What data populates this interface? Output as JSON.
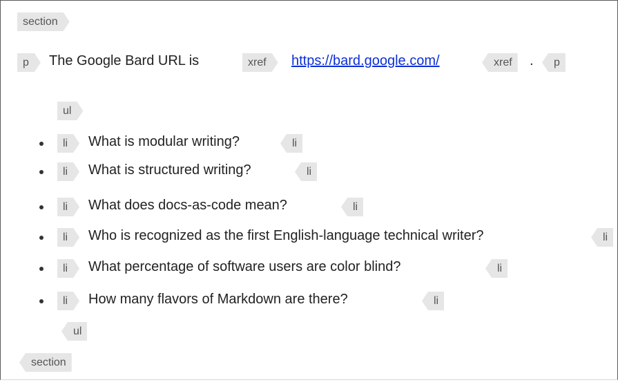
{
  "section_tag": "section",
  "paragraph": {
    "p_tag": "p",
    "lead_text": "The Google Bard URL is",
    "xref_tag": "xref",
    "link_text": "https://bard.google.com/",
    "trailing": "."
  },
  "list": {
    "ul_tag": "ul",
    "li_tag": "li",
    "items": [
      "What is modular writing?",
      "What is structured writing?",
      "What does docs-as-code mean?",
      "Who is recognized as the first English-language technical writer?",
      "What percentage of software users are color blind?",
      "How many flavors of Markdown are there?"
    ]
  }
}
